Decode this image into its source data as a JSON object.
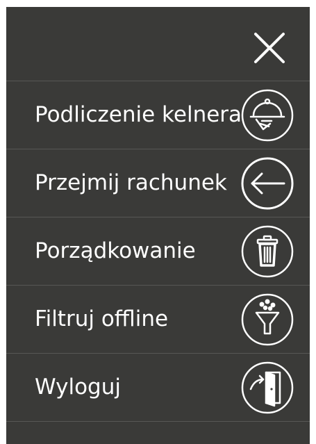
{
  "menu": {
    "close_icon": "close-icon",
    "items": [
      {
        "label": "Podliczenie kelnera",
        "icon": "cloche-icon"
      },
      {
        "label": "Przejmij rachunek",
        "icon": "arrow-left-icon"
      },
      {
        "label": "Porządkowanie",
        "icon": "trash-icon"
      },
      {
        "label": "Filtruj offline",
        "icon": "funnel-icon"
      },
      {
        "label": "Wyloguj",
        "icon": "logout-door-icon"
      }
    ]
  },
  "colors": {
    "panel_background": "#3a3a38",
    "divider": "#575755",
    "foreground": "#ffffff"
  }
}
